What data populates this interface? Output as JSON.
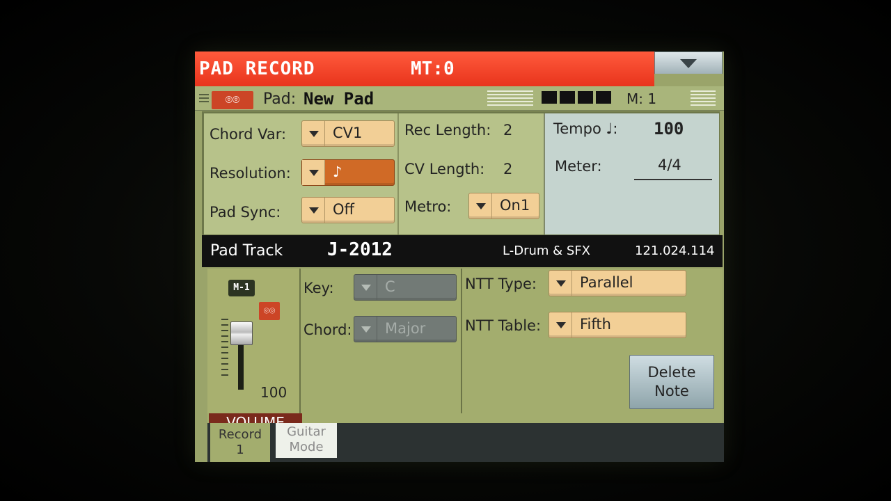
{
  "header": {
    "title": "PAD RECORD",
    "mt": "MT:0",
    "menu_icon": "triangle-down"
  },
  "info": {
    "pad_label": "Pad:",
    "pad_name": "New Pad",
    "measure": "M: 1"
  },
  "params": {
    "chord_var_label": "Chord Var:",
    "chord_var_value": "CV1",
    "resolution_label": "Resolution:",
    "resolution_value": "♪",
    "pad_sync_label": "Pad Sync:",
    "pad_sync_value": "Off",
    "rec_length_label": "Rec Length:",
    "rec_length_value": "2",
    "cv_length_label": "CV Length:",
    "cv_length_value": "2",
    "metro_label": "Metro:",
    "metro_value": "On1",
    "tempo_label": "Tempo ♩:",
    "tempo_value": "100",
    "meter_label": "Meter:",
    "meter_value": "4/4"
  },
  "track": {
    "label": "Pad Track",
    "sound_name": "J-2012",
    "category": "L-Drum & SFX",
    "program_id": "121.024.114"
  },
  "mixer": {
    "track_chip": "M-1",
    "volume_value": "100",
    "volume_label": "VOLUME",
    "volume_level": 100
  },
  "key": {
    "key_label": "Key:",
    "key_value": "C",
    "chord_label": "Chord:",
    "chord_value": "Major"
  },
  "ntt": {
    "type_label": "NTT Type:",
    "type_value": "Parallel",
    "table_label": "NTT Table:",
    "table_value": "Fifth",
    "delete_line1": "Delete",
    "delete_line2": "Note"
  },
  "tabs": {
    "record_line1": "Record",
    "record_line2": "1",
    "guitar_line1": "Guitar",
    "guitar_line2": "Mode"
  },
  "colors": {
    "title_bar": "#e8341c",
    "panel_green": "#9aa46a",
    "dropdown": "#f2cf96",
    "selected_dropdown": "#d06a26",
    "info_blue": "#c5d4cf"
  }
}
